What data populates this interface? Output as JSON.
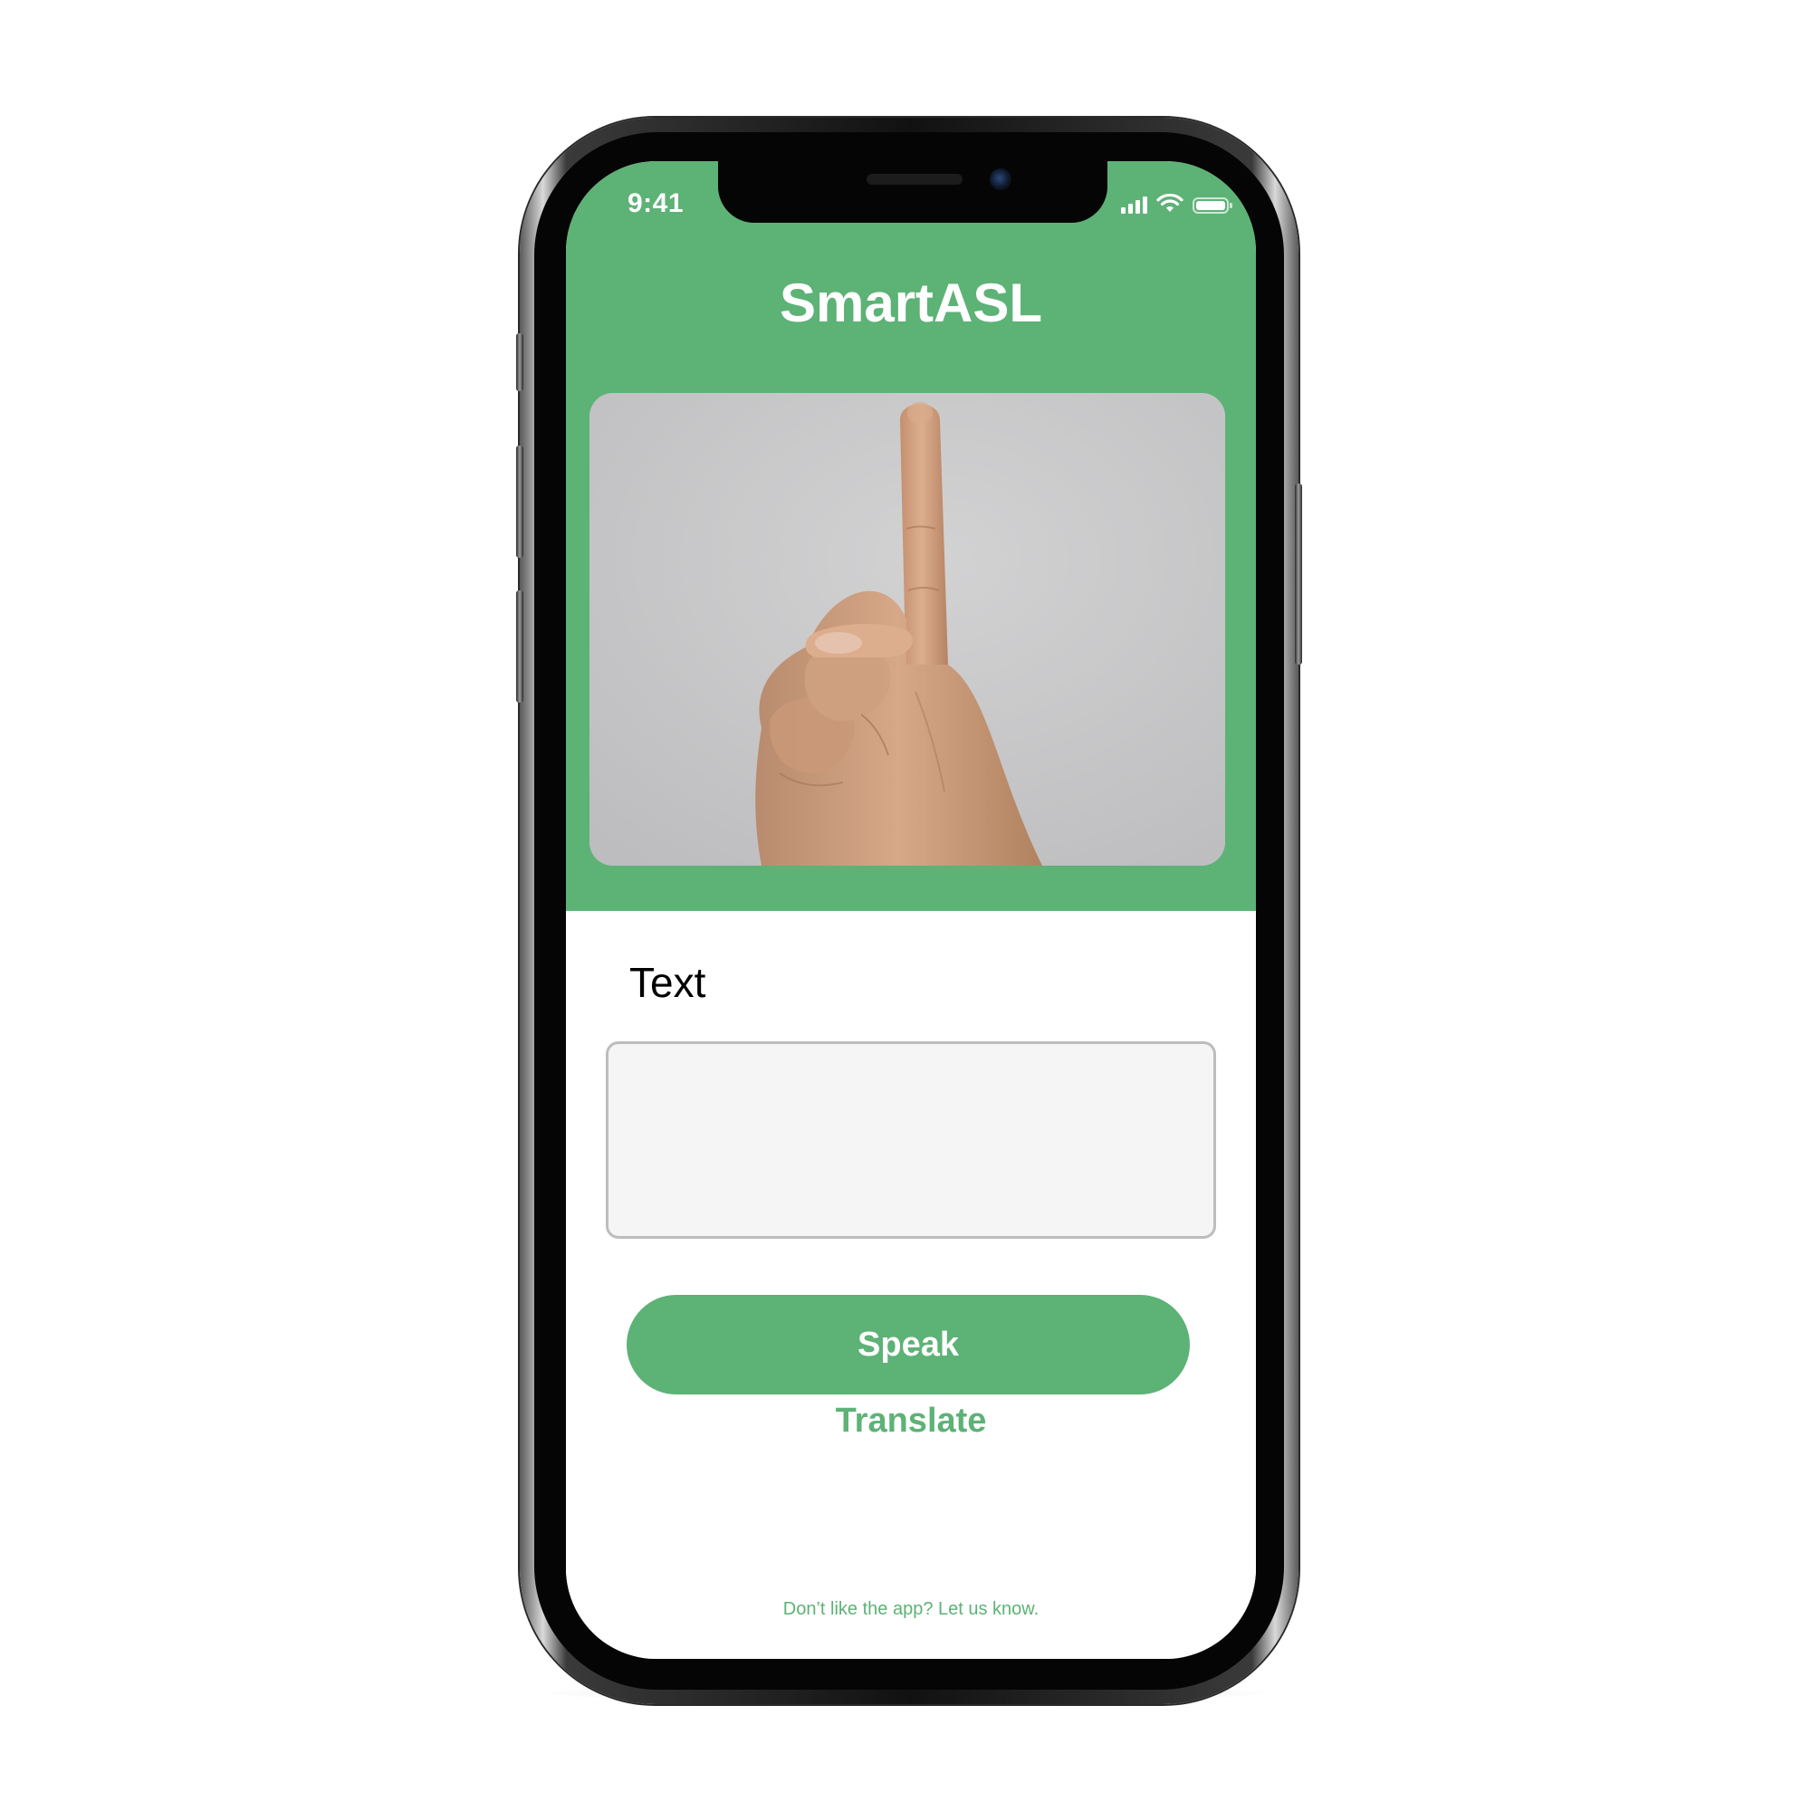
{
  "status_bar": {
    "time": "9:41",
    "icons": [
      "signal-icon",
      "wifi-icon",
      "battery-icon"
    ]
  },
  "header": {
    "title": "SmartASL"
  },
  "camera": {
    "subject": "hand-sign-image"
  },
  "main": {
    "section_label": "Text",
    "text_value": "",
    "speak_label": "Speak",
    "translate_label": "Translate"
  },
  "footer": {
    "feedback_text": "Don’t like the app? Let us know."
  },
  "colors": {
    "accent": "#5db276",
    "input_bg": "#f5f5f5",
    "input_border": "#bdbdbd",
    "title_text": "#ffffff"
  }
}
